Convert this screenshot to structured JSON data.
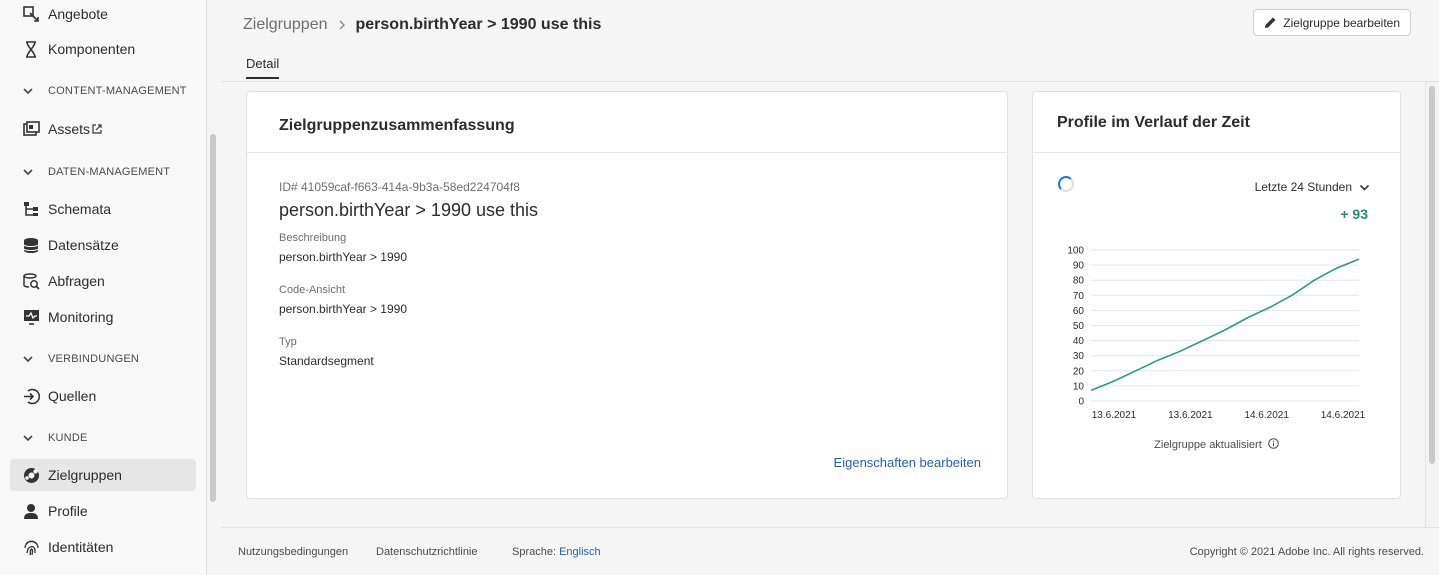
{
  "sidebar": {
    "items": [
      {
        "label": "Angebote",
        "icon": "offers-icon"
      },
      {
        "label": "Komponenten",
        "icon": "components-icon"
      },
      {
        "label": "Assets",
        "icon": "assets-icon",
        "external": "external-link-icon"
      },
      {
        "label": "Schemata",
        "icon": "schema-icon"
      },
      {
        "label": "Datensätze",
        "icon": "datasets-icon"
      },
      {
        "label": "Abfragen",
        "icon": "queries-icon"
      },
      {
        "label": "Monitoring",
        "icon": "monitoring-icon"
      },
      {
        "label": "Quellen",
        "icon": "sources-icon"
      },
      {
        "label": "Zielgruppen",
        "icon": "audiences-icon",
        "active": true
      },
      {
        "label": "Profile",
        "icon": "profile-icon"
      },
      {
        "label": "Identitäten",
        "icon": "fingerprint-icon"
      }
    ],
    "sections": [
      "CONTENT-MANAGEMENT",
      "DATEN-MANAGEMENT",
      "VERBINDUNGEN",
      "KUNDE"
    ]
  },
  "header": {
    "breadcrumb_root": "Zielgruppen",
    "breadcrumb_current": "person.birthYear > 1990 use this",
    "edit_button": "Zielgruppe bearbeiten",
    "tab": "Detail"
  },
  "summary": {
    "title": "Zielgruppenzusammenfassung",
    "id": "ID# 41059caf-f663-414a-9b3a-58ed224704f8",
    "name": "person.birthYear > 1990 use this",
    "description_label": "Beschreibung",
    "description": "person.birthYear > 1990",
    "code_label": "Code-Ansicht",
    "code": "person.birthYear > 1990",
    "type_label": "Typ",
    "type": "Standardsegment",
    "edit_link": "Eigenschaften bearbeiten"
  },
  "profiles": {
    "title": "Profile im Verlauf der Zeit",
    "range": "Letzte 24 Stunden",
    "delta": "+ 93",
    "updated": "Zielgruppe aktualisiert"
  },
  "chart_data": {
    "type": "line",
    "title": "",
    "xlabel": "",
    "ylabel": "",
    "ylim": [
      0,
      100
    ],
    "yticks": [
      0,
      10,
      20,
      30,
      40,
      50,
      60,
      70,
      80,
      90,
      100
    ],
    "xticks": [
      "13.6.2021",
      "13.6.2021",
      "14.6.2021",
      "14.6.2021"
    ],
    "grid": true,
    "color": "#2d9d78",
    "series": [
      {
        "values": [
          7,
          13,
          20,
          27,
          33,
          40,
          47,
          55,
          62,
          70,
          80,
          88,
          94
        ]
      }
    ]
  },
  "footer": {
    "terms": "Nutzungsbedingungen",
    "privacy": "Datenschutzrichtlinie",
    "language_label": "Sprache:",
    "language": "Englisch",
    "copyright": "Copyright ©  2021 Adobe Inc.  All rights reserved."
  }
}
